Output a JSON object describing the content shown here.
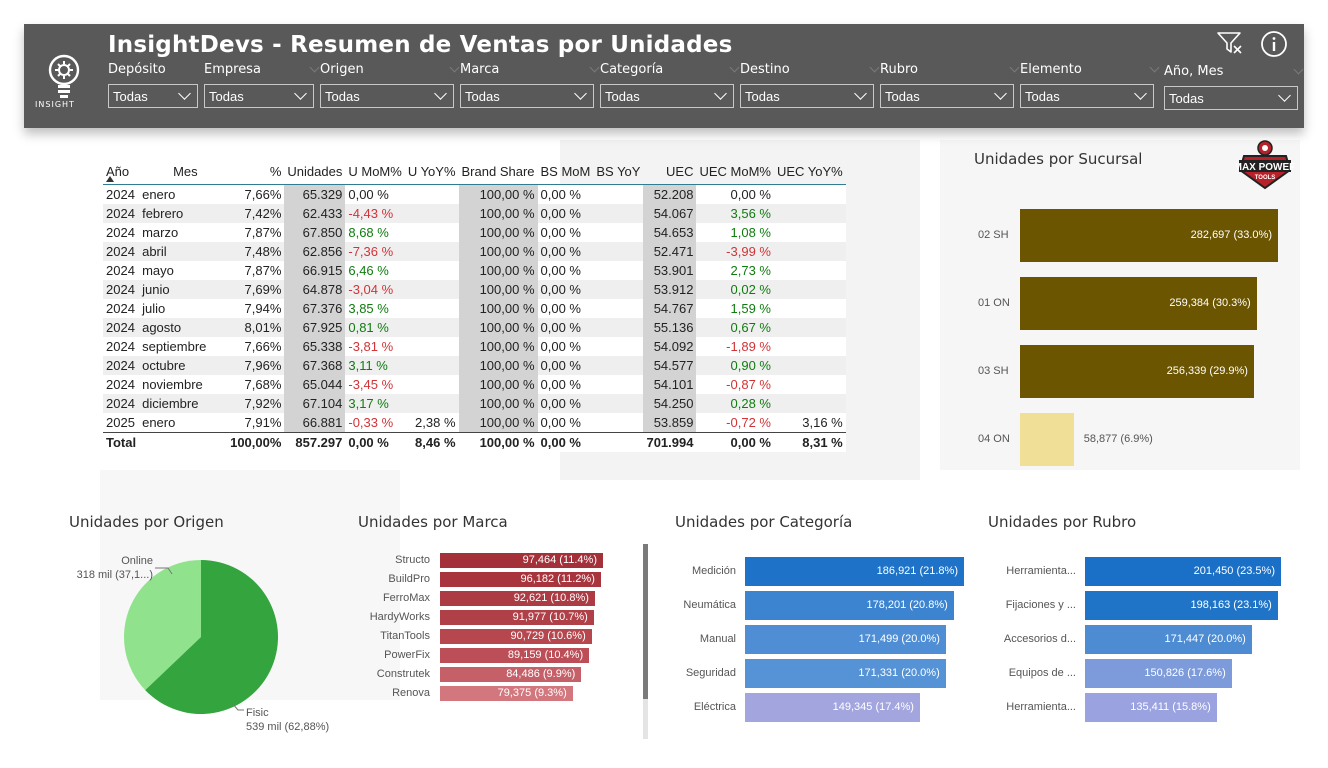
{
  "header": {
    "title": "InsightDevs - Resumen de Ventas por Unidades",
    "logo_text": "INSIGHT",
    "filters": [
      {
        "label": "Depósito",
        "value": "Todas"
      },
      {
        "label": "Empresa",
        "value": "Todas"
      },
      {
        "label": "Origen",
        "value": "Todas"
      },
      {
        "label": "Marca",
        "value": "Todas"
      },
      {
        "label": "Categoría",
        "value": "Todas"
      },
      {
        "label": "Destino",
        "value": "Todas"
      },
      {
        "label": "Rubro",
        "value": "Todas"
      },
      {
        "label": "Elemento",
        "value": "Todas"
      },
      {
        "label": "Año, Mes",
        "value": "Todas"
      }
    ],
    "icons": {
      "clear_filters": "filter-clear-icon",
      "info": "info-icon"
    }
  },
  "table": {
    "columns": [
      "Año",
      "Mes",
      "%",
      "Unidades",
      "U MoM%",
      "U YoY%",
      "Brand Share",
      "BS MoM",
      "BS YoY",
      "UEC",
      "UEC MoM%",
      "UEC YoY%"
    ],
    "rows": [
      [
        "2024",
        "enero",
        "7,66%",
        "65.329",
        "0,00 %",
        "",
        "100,00 %",
        "0,00 %",
        "",
        "52.208",
        "0,00 %",
        ""
      ],
      [
        "2024",
        "febrero",
        "7,42%",
        "62.433",
        "-4,43 %",
        "",
        "100,00 %",
        "0,00 %",
        "",
        "54.067",
        "3,56 %",
        ""
      ],
      [
        "2024",
        "marzo",
        "7,87%",
        "67.850",
        "8,68 %",
        "",
        "100,00 %",
        "0,00 %",
        "",
        "54.653",
        "1,08 %",
        ""
      ],
      [
        "2024",
        "abril",
        "7,48%",
        "62.856",
        "-7,36 %",
        "",
        "100,00 %",
        "0,00 %",
        "",
        "52.471",
        "-3,99 %",
        ""
      ],
      [
        "2024",
        "mayo",
        "7,87%",
        "66.915",
        "6,46 %",
        "",
        "100,00 %",
        "0,00 %",
        "",
        "53.901",
        "2,73 %",
        ""
      ],
      [
        "2024",
        "junio",
        "7,69%",
        "64.878",
        "-3,04 %",
        "",
        "100,00 %",
        "0,00 %",
        "",
        "53.912",
        "0,02 %",
        ""
      ],
      [
        "2024",
        "julio",
        "7,94%",
        "67.376",
        "3,85 %",
        "",
        "100,00 %",
        "0,00 %",
        "",
        "54.767",
        "1,59 %",
        ""
      ],
      [
        "2024",
        "agosto",
        "8,01%",
        "67.925",
        "0,81 %",
        "",
        "100,00 %",
        "0,00 %",
        "",
        "55.136",
        "0,67 %",
        ""
      ],
      [
        "2024",
        "septiembre",
        "7,66%",
        "65.338",
        "-3,81 %",
        "",
        "100,00 %",
        "0,00 %",
        "",
        "54.092",
        "-1,89 %",
        ""
      ],
      [
        "2024",
        "octubre",
        "7,96%",
        "67.368",
        "3,11 %",
        "",
        "100,00 %",
        "0,00 %",
        "",
        "54.577",
        "0,90 %",
        ""
      ],
      [
        "2024",
        "noviembre",
        "7,68%",
        "65.044",
        "-3,45 %",
        "",
        "100,00 %",
        "0,00 %",
        "",
        "54.101",
        "-0,87 %",
        ""
      ],
      [
        "2024",
        "diciembre",
        "7,92%",
        "67.104",
        "3,17 %",
        "",
        "100,00 %",
        "0,00 %",
        "",
        "54.250",
        "0,28 %",
        ""
      ],
      [
        "2025",
        "enero",
        "7,91%",
        "66.881",
        "-0,33 %",
        "2,38 %",
        "100,00 %",
        "0,00 %",
        "",
        "53.859",
        "-0,72 %",
        "3,16 %"
      ]
    ],
    "total": [
      "Total",
      "",
      "100,00%",
      "857.297",
      "0,00 %",
      "8,46 %",
      "100,00 %",
      "0,00 %",
      "",
      "701.994",
      "0,00 %",
      "8,31 %"
    ]
  },
  "chart_data": [
    {
      "type": "bar",
      "title": "Unidades por Sucursal",
      "orientation": "horizontal",
      "categories": [
        "02 SH",
        "01 ON",
        "03 SH",
        "04 ON"
      ],
      "values": [
        282697,
        259384,
        256339,
        58877
      ],
      "labels": [
        "282,697 (33.0%)",
        "259,384 (30.3%)",
        "256,339 (29.9%)",
        "58,877 (6.9%)"
      ],
      "colors": [
        "#6b5500",
        "#6b5500",
        "#6b5500",
        "#f0df96"
      ]
    },
    {
      "type": "pie",
      "title": "Unidades por Origen",
      "categories": [
        "Online",
        "Fisic"
      ],
      "values": [
        318,
        539
      ],
      "labels": [
        "318 mil (37,1...)",
        "539 mil (62,88%)"
      ],
      "colors": [
        "#90e38c",
        "#33a43e"
      ]
    },
    {
      "type": "bar",
      "title": "Unidades por Marca",
      "orientation": "horizontal",
      "categories": [
        "Structo",
        "BuildPro",
        "FerroMax",
        "HardyWorks",
        "TitanTools",
        "PowerFix",
        "Construtek",
        "Renova"
      ],
      "values": [
        97464,
        96182,
        92621,
        91977,
        90729,
        89159,
        84486,
        79375
      ],
      "labels": [
        "97,464 (11.4%)",
        "96,182 (11.2%)",
        "92,621 (10.8%)",
        "91,977 (10.7%)",
        "90,729 (10.6%)",
        "89,159 (10.4%)",
        "84,486 (9.9%)",
        "79,375 (9.3%)"
      ],
      "colors": [
        "#a4313a",
        "#a8353d",
        "#ac3b43",
        "#b04048",
        "#b6474f",
        "#bb4e56",
        "#c66068",
        "#d3777e"
      ]
    },
    {
      "type": "bar",
      "title": "Unidades por Categoría",
      "orientation": "horizontal",
      "categories": [
        "Medición",
        "Neumática",
        "Manual",
        "Seguridad",
        "Eléctrica"
      ],
      "values": [
        186921,
        178201,
        171499,
        171331,
        149345
      ],
      "labels": [
        "186,921 (21.8%)",
        "178,201 (20.8%)",
        "171,499 (20.0%)",
        "171,331 (20.0%)",
        "149,345 (17.4%)"
      ],
      "colors": [
        "#1e73c8",
        "#3c84d0",
        "#4f8ed4",
        "#5593d6",
        "#a3a6de"
      ]
    },
    {
      "type": "bar",
      "title": "Unidades por Rubro",
      "orientation": "horizontal",
      "categories": [
        "Herramienta...",
        "Fijaciones y ...",
        "Accesorios d...",
        "Equipos de ...",
        "Herramienta..."
      ],
      "values": [
        201450,
        198163,
        171447,
        150826,
        135411
      ],
      "labels": [
        "201,450 (23.5%)",
        "198,163 (23.1%)",
        "171,447 (20.0%)",
        "150,826 (17.6%)",
        "135,411 (15.8%)"
      ],
      "colors": [
        "#1a70c6",
        "#1f74c8",
        "#4d8cd3",
        "#7d9bda",
        "#9aa2df"
      ]
    }
  ],
  "brand_logo": {
    "line1": "MAX POWER",
    "line2": "TOOLS"
  }
}
